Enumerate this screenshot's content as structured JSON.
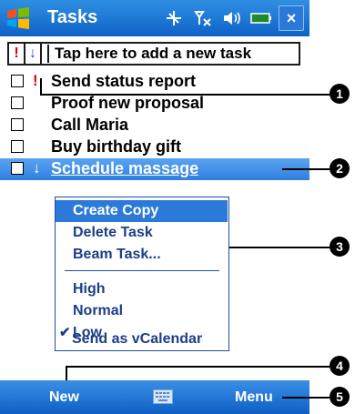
{
  "titlebar": {
    "title": "Tasks",
    "icons": [
      "start-logo-icon",
      "connectivity-icon",
      "signal-icon",
      "volume-icon",
      "battery-icon"
    ],
    "close_label": "×"
  },
  "entrybar": {
    "high_label": "!",
    "low_label": "↓",
    "placeholder": "Tap here to add a new task"
  },
  "tasks": [
    {
      "label": "Send status report",
      "priority": "!",
      "priority_level": "high"
    },
    {
      "label": "Proof new proposal",
      "priority": "",
      "priority_level": "normal"
    },
    {
      "label": "Call Maria",
      "priority": "",
      "priority_level": "normal"
    },
    {
      "label": "Buy birthday gift",
      "priority": "",
      "priority_level": "normal"
    },
    {
      "label": "Schedule massage",
      "priority": "↓",
      "priority_level": "low",
      "selected": true
    }
  ],
  "context_menu": {
    "items": [
      {
        "label": "Create Copy",
        "highlighted": true
      },
      {
        "label": "Delete Task"
      },
      {
        "label": "Beam Task..."
      },
      {
        "label": "High"
      },
      {
        "label": "Normal"
      },
      {
        "label": "Low",
        "checked": true
      },
      {
        "label": "Send as vCalendar"
      }
    ],
    "check_mark": "✔"
  },
  "bottombar": {
    "new_label": "New",
    "menu_label": "Menu"
  },
  "callouts": [
    "1",
    "2",
    "3",
    "4",
    "5"
  ]
}
